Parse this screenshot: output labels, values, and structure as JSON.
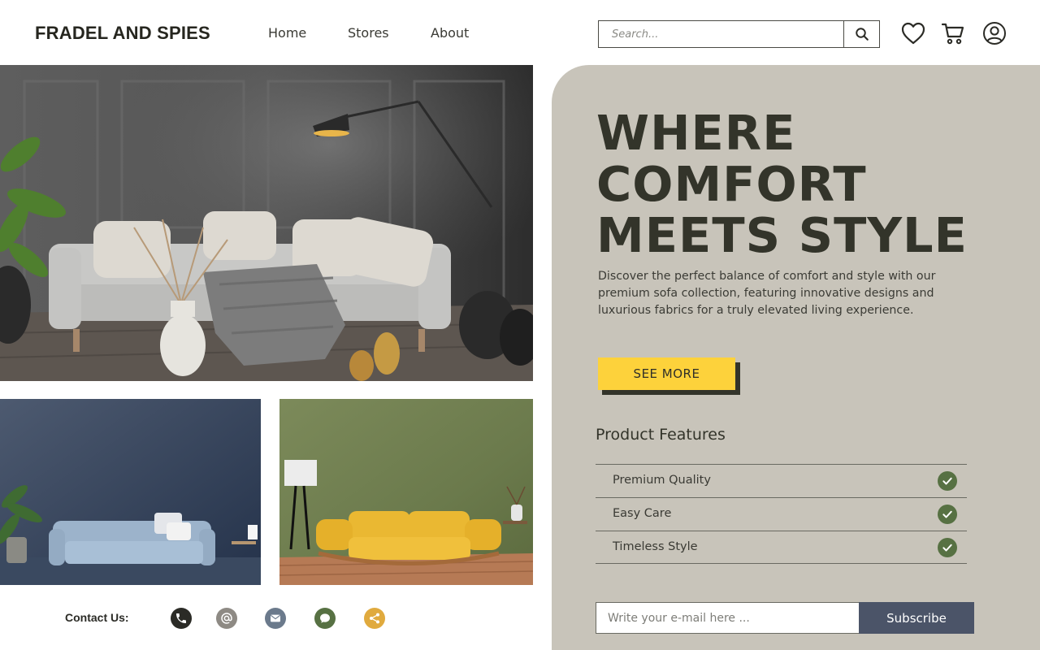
{
  "header": {
    "brand": "FRADEL AND SPIES",
    "nav": [
      "Home",
      "Stores",
      "About"
    ],
    "search_placeholder": "Search...",
    "icons": [
      "search-icon",
      "heart-icon",
      "cart-icon",
      "user-icon"
    ]
  },
  "hero": {
    "title_lines": [
      "WHERE",
      "COMFORT",
      "MEETS STYLE"
    ],
    "description": "Discover the perfect balance of comfort and style with our premium sofa collection, featuring innovative designs and luxurious fabrics for a truly elevated living experience.",
    "cta_label": "SEE MORE"
  },
  "features": {
    "title": "Product Features",
    "items": [
      {
        "label": "Premium Quality",
        "checked": true
      },
      {
        "label": "Easy Care",
        "checked": true
      },
      {
        "label": "Timeless Style",
        "checked": true
      }
    ]
  },
  "subscribe": {
    "placeholder": "Write your e-mail here ...",
    "button_label": "Subscribe"
  },
  "contact": {
    "label": "Contact Us:",
    "icons": [
      {
        "name": "phone-icon",
        "color": "#2b2b26"
      },
      {
        "name": "at-icon",
        "color": "#8e8a84"
      },
      {
        "name": "mail-icon",
        "color": "#6b7a8c"
      },
      {
        "name": "chat-icon",
        "color": "#577143"
      },
      {
        "name": "share-icon",
        "color": "#e0aa3e"
      }
    ]
  },
  "colors": {
    "panel_bg": "#c8c4ba",
    "accent_yellow": "#fdd23b",
    "check_green": "#577143",
    "subscribe_bg": "#4b5468",
    "title_text": "#33342a"
  }
}
